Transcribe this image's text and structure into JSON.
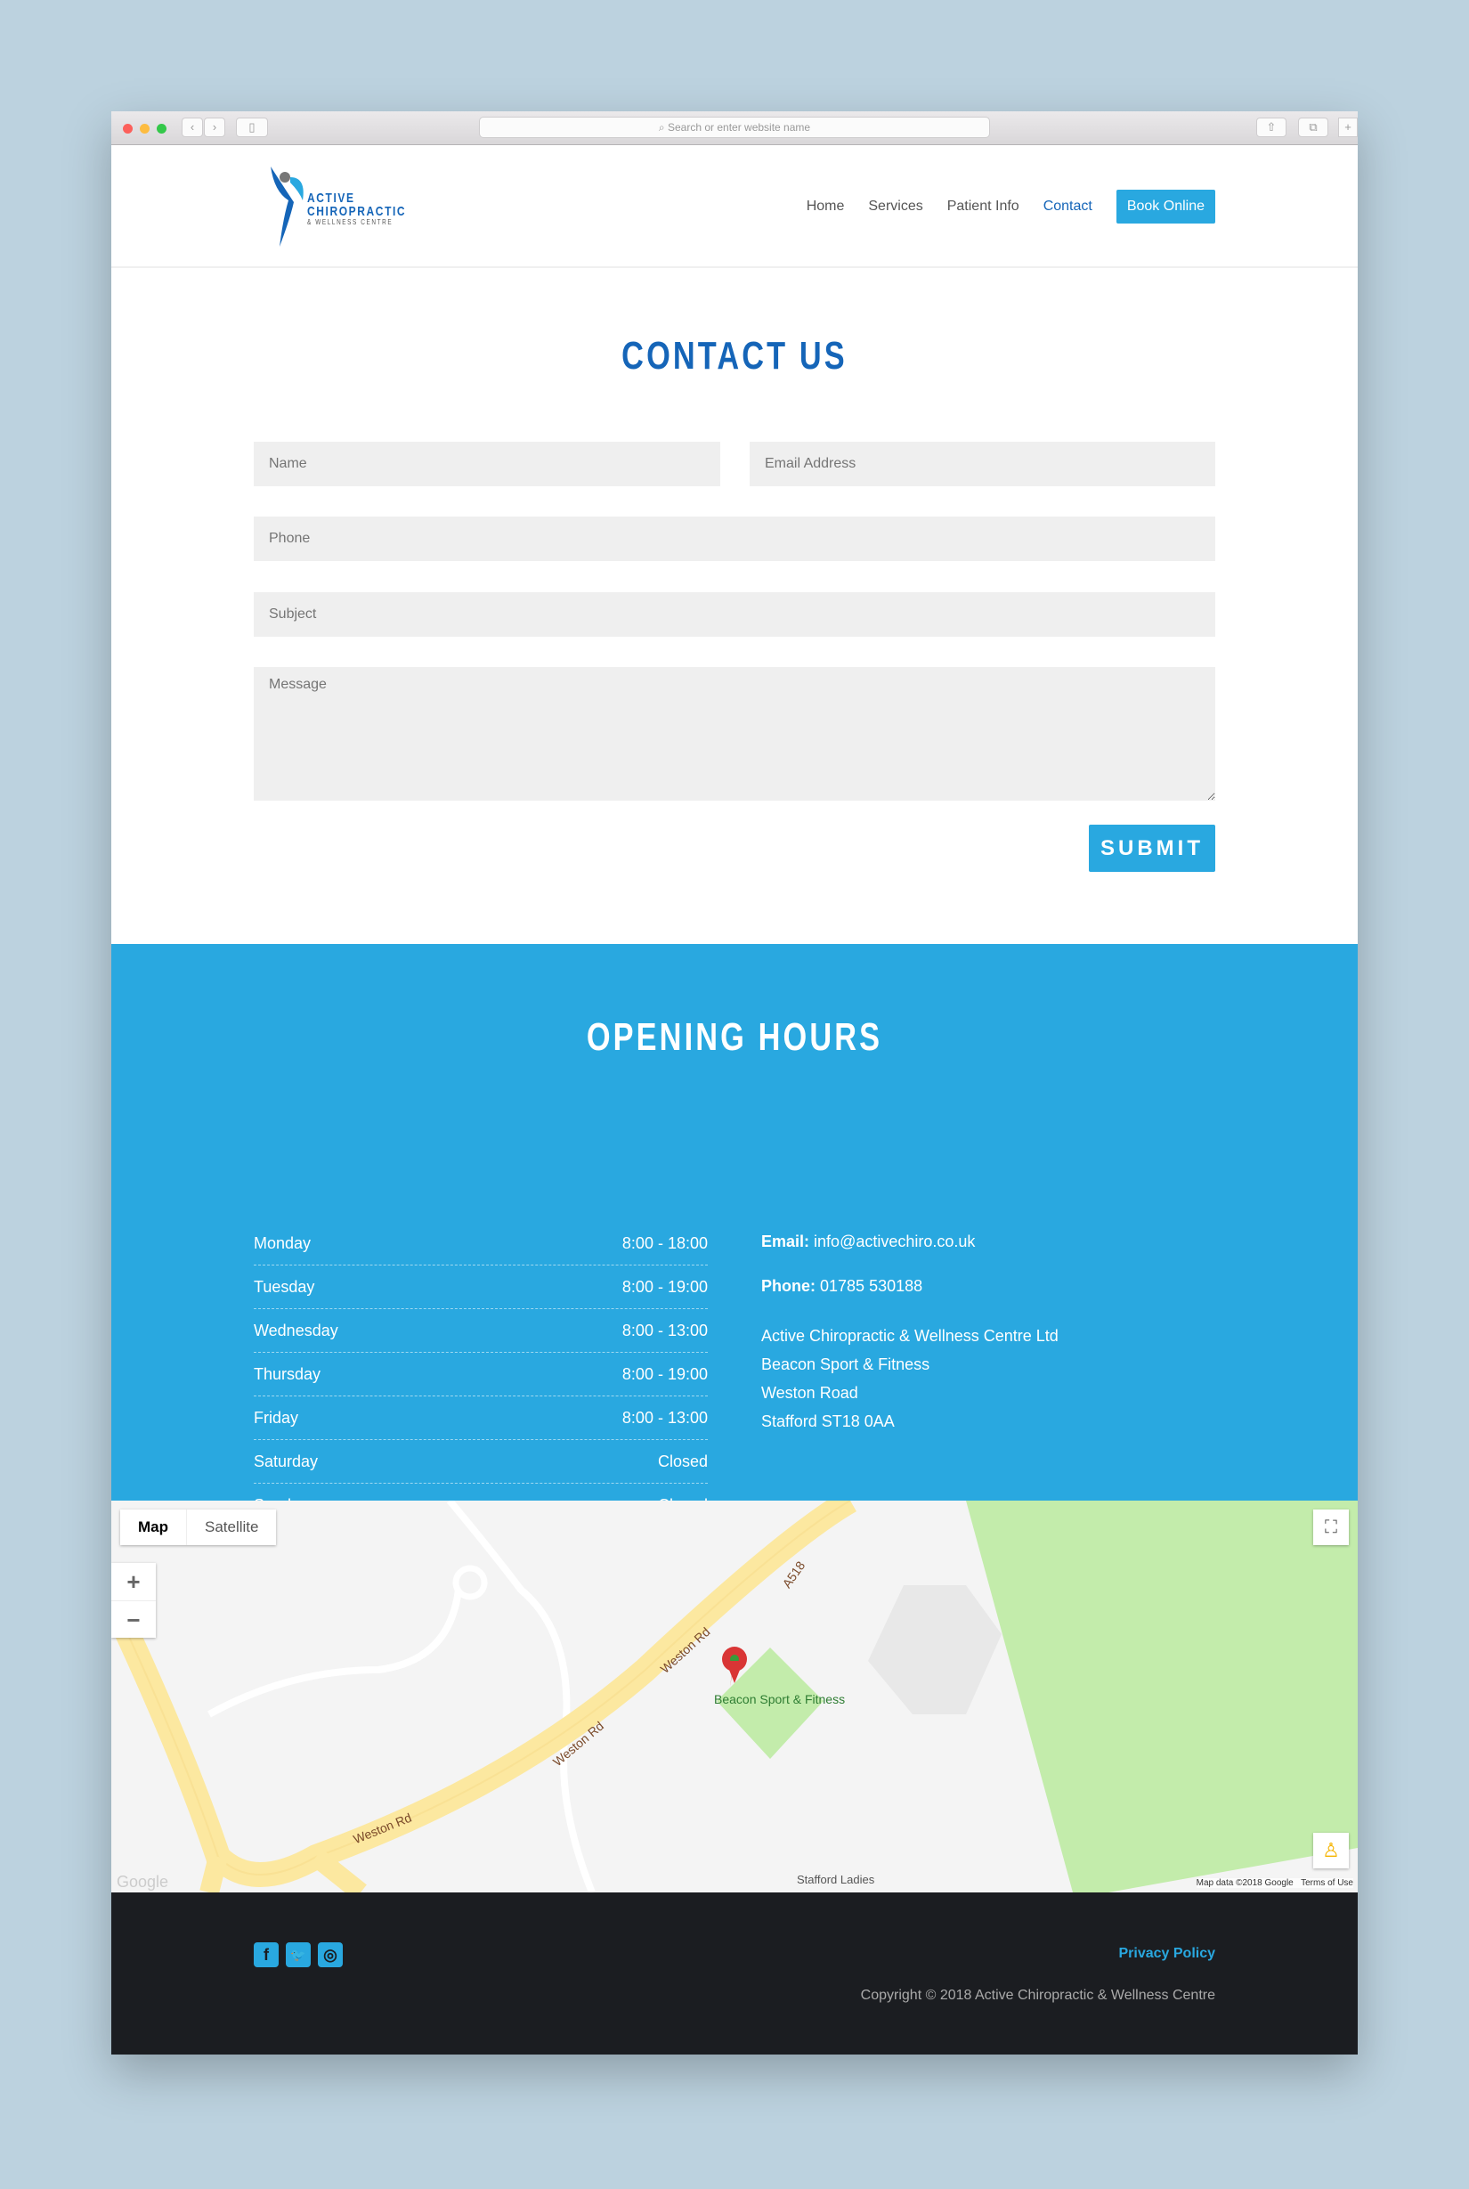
{
  "browser": {
    "url_placeholder": "Search or enter website name"
  },
  "brand": {
    "name_line1": "ACTIVE",
    "name_line2": "CHIROPRACTIC",
    "tagline": "& WELLNESS CENTRE",
    "accent": "#29a8e0",
    "dark_blue": "#1565b8"
  },
  "nav": {
    "items": [
      "Home",
      "Services",
      "Patient Info",
      "Contact"
    ],
    "active": "Contact",
    "book": "Book Online"
  },
  "contact": {
    "title": "CONTACT US",
    "name_placeholder": "Name",
    "email_placeholder": "Email Address",
    "phone_placeholder": "Phone",
    "subject_placeholder": "Subject",
    "message_placeholder": "Message",
    "submit": "SUBMIT"
  },
  "hours": {
    "title": "OPENING HOURS",
    "rows": [
      {
        "day": "Monday",
        "time": "8:00 - 18:00"
      },
      {
        "day": "Tuesday",
        "time": "8:00 - 19:00"
      },
      {
        "day": "Wednesday",
        "time": "8:00 - 13:00"
      },
      {
        "day": "Thursday",
        "time": "8:00 - 19:00"
      },
      {
        "day": "Friday",
        "time": "8:00 - 13:00"
      },
      {
        "day": "Saturday",
        "time": "Closed"
      },
      {
        "day": "Sunday",
        "time": "Closed"
      }
    ]
  },
  "info": {
    "email_label": "Email:",
    "email": "info@activechiro.co.uk",
    "phone_label": "Phone:",
    "phone": "01785 530188",
    "address": [
      "Active Chiropractic & Wellness Centre Ltd",
      "Beacon Sport & Fitness",
      "Weston Road",
      "Stafford ST18 0AA"
    ]
  },
  "map": {
    "tab_map": "Map",
    "tab_satellite": "Satellite",
    "zoom_in": "+",
    "zoom_out": "−",
    "place": "Beacon Sport & Fitness",
    "road1": "Weston Rd",
    "road2": "A518",
    "poi": "Stafford Ladies",
    "attribution": "Map data ©2018 Google",
    "terms": "Terms of Use",
    "logo": "Google"
  },
  "footer": {
    "privacy": "Privacy Policy",
    "copyright": "Copyright © 2018 Active Chiropractic & Wellness Centre",
    "social": [
      "facebook",
      "twitter",
      "instagram"
    ]
  }
}
